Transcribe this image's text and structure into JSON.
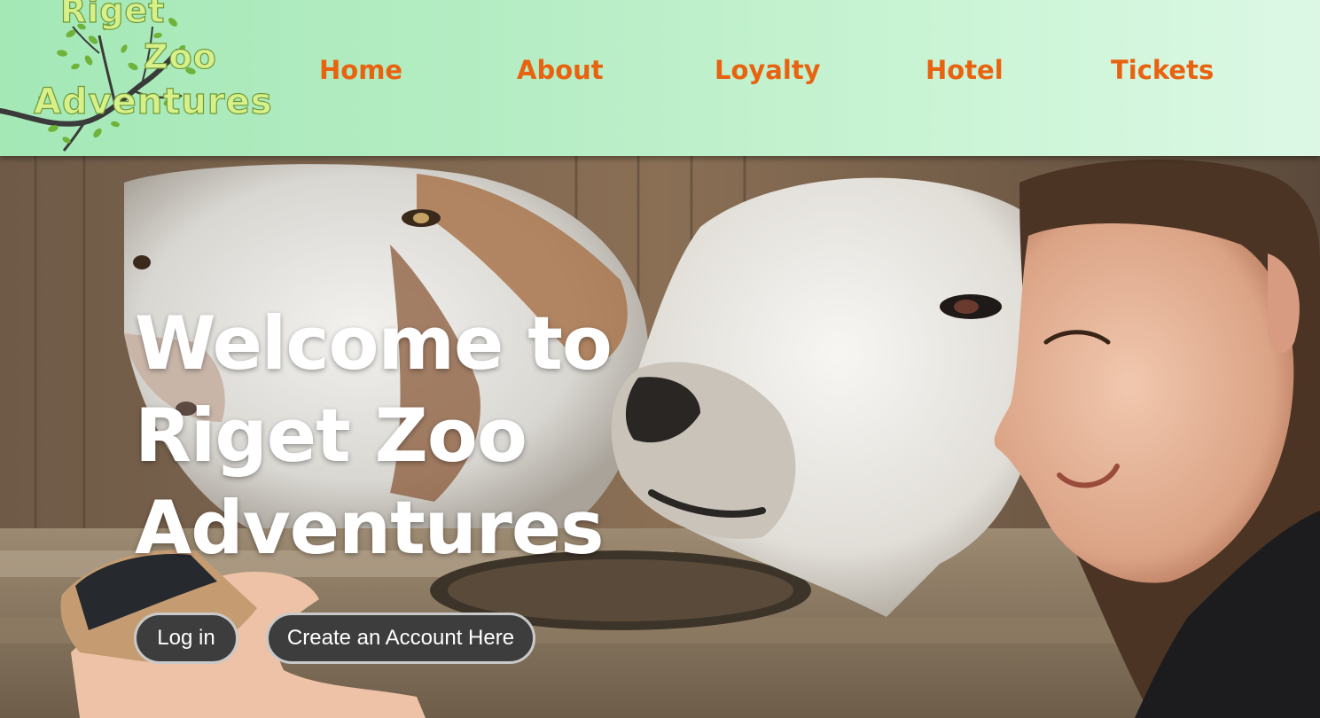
{
  "logo": {
    "line1": "Riget",
    "line2": "Zoo",
    "line3": "Adventures"
  },
  "nav": {
    "items": [
      {
        "label": "Home"
      },
      {
        "label": "About"
      },
      {
        "label": "Loyalty"
      },
      {
        "label": "Hotel"
      },
      {
        "label": "Tickets"
      }
    ]
  },
  "hero": {
    "title_line1": "Welcome to",
    "title_line2": "Riget Zoo",
    "title_line3": "Adventures",
    "login_label": "Log in",
    "create_account_label": "Create an Account Here"
  },
  "colors": {
    "nav_text": "#e8620f",
    "header_bg": "#b6edc4",
    "button_bg": "#3d3d3d",
    "button_border": "#c9c9c9"
  }
}
